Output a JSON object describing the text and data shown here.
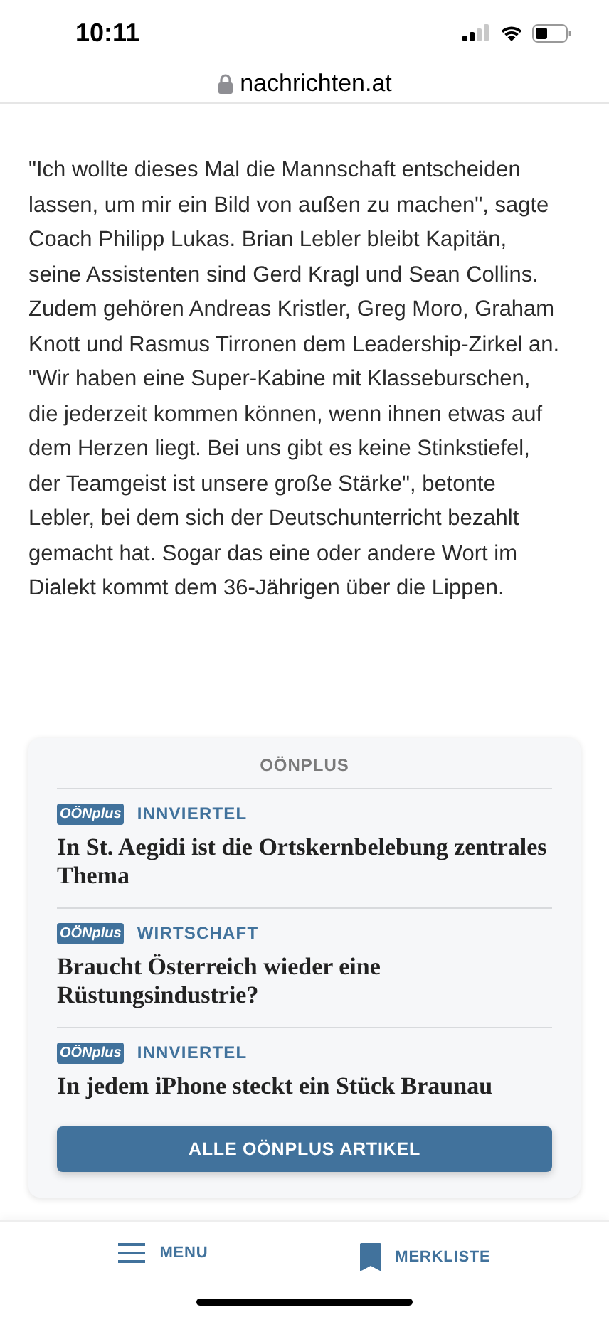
{
  "status_bar": {
    "time": "10:11"
  },
  "address_bar": {
    "url": "nachrichten.at"
  },
  "article": {
    "paragraph": "\"Ich wollte dieses Mal die Mannschaft entscheiden lassen, um mir ein Bild von außen zu machen\", sagte Coach Philipp Lukas. Brian Lebler bleibt Kapitän, seine Assistenten sind Gerd Kragl und Sean Collins. Zudem gehören Andreas Kristler, Greg Moro, Graham Knott und Rasmus Tirronen dem Leadership-Zirkel an. \"Wir haben eine Super-Kabine mit Klasseburschen, die jederzeit kommen können, wenn ihnen etwas auf dem Herzen liegt. Bei uns gibt es keine Stinkstiefel, der Teamgeist ist unsere große Stärke\", betonte Lebler, bei dem sich der Deutschunterricht bezahlt gemacht hat. Sogar das eine oder andere Wort im Dialekt kommt dem 36-Jährigen über die Lippen."
  },
  "teaser_box": {
    "title": "OÖNPLUS",
    "items": [
      {
        "badge": "OÖNplus",
        "category": "INNVIERTEL",
        "headline": "In St. Aegidi ist die Ortskernbelebung zentrales Thema"
      },
      {
        "badge": "OÖNplus",
        "category": "WIRTSCHAFT",
        "headline": "Braucht Österreich wieder eine Rüstungsindustrie?"
      },
      {
        "badge": "OÖNplus",
        "category": "INNVIERTEL",
        "headline": "In jedem iPhone steckt ein Stück Braunau"
      }
    ],
    "button": "ALLE OÖNPLUS ARTIKEL"
  },
  "bottom_nav": [
    {
      "kind": "menu",
      "label": "MENU"
    },
    {
      "kind": "bookmark",
      "label": "MERKLISTE"
    }
  ]
}
